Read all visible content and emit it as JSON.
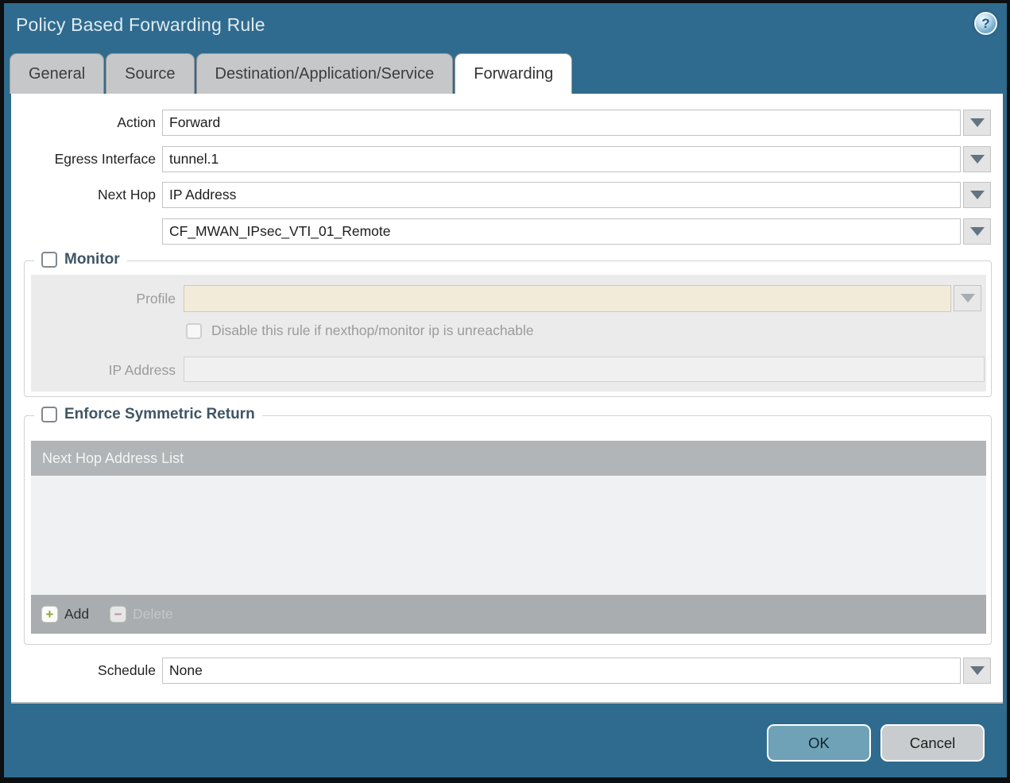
{
  "window": {
    "title": "Policy Based Forwarding Rule"
  },
  "icons": {
    "help_glyph": "?",
    "add_glyph": "+",
    "delete_glyph": "−"
  },
  "tabs": [
    {
      "label": "General",
      "active": false
    },
    {
      "label": "Source",
      "active": false
    },
    {
      "label": "Destination/Application/Service",
      "active": false
    },
    {
      "label": "Forwarding",
      "active": true
    }
  ],
  "form": {
    "action": {
      "label": "Action",
      "value": "Forward"
    },
    "egress_interface": {
      "label": "Egress Interface",
      "value": "tunnel.1"
    },
    "next_hop": {
      "label": "Next Hop",
      "value": "IP Address"
    },
    "next_hop_address": {
      "value": "CF_MWAN_IPsec_VTI_01_Remote"
    },
    "schedule": {
      "label": "Schedule",
      "value": "None"
    }
  },
  "monitor": {
    "title": "Monitor",
    "checked": false,
    "profile": {
      "label": "Profile",
      "value": ""
    },
    "disable_rule": {
      "label": "Disable this rule if nexthop/monitor ip is unreachable",
      "checked": false
    },
    "ip_address": {
      "label": "IP Address",
      "value": ""
    }
  },
  "enforce_symmetric_return": {
    "title": "Enforce Symmetric Return",
    "checked": false,
    "table": {
      "header": "Next Hop Address List",
      "rows": []
    },
    "toolbar": {
      "add_label": "Add",
      "delete_label": "Delete",
      "delete_enabled": false
    }
  },
  "footer": {
    "ok_label": "OK",
    "cancel_label": "Cancel"
  },
  "colors": {
    "titlebar": "#2F6B8E",
    "active_tab": "#FFFFFF",
    "inactive_tab": "#C6C7C8",
    "ok_button": "#6FA2B6",
    "cancel_button": "#C9CCCE",
    "profile_field_disabled": "#F2EBD9",
    "table_header": "#B2B5B7",
    "toolbar": "#A9ADB0",
    "add_icon_green": "#96A23B",
    "delete_icon_red": "#C87F8A"
  }
}
